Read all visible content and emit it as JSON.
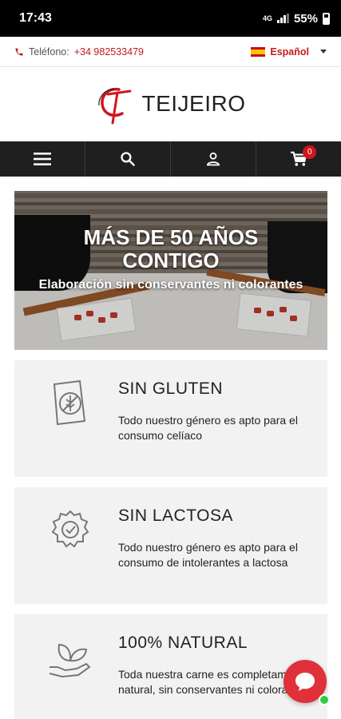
{
  "status_bar": {
    "time": "17:43",
    "network": "4G",
    "battery": "55%"
  },
  "topbar": {
    "phone_label": "Teléfono:",
    "phone_number": "+34 982533479",
    "language": "Español"
  },
  "brand": {
    "name": "TEIJEIRO",
    "accent": "#d0161c"
  },
  "navbar": {
    "menu_icon": "hamburger-icon",
    "search_icon": "search-icon",
    "account_icon": "user-icon",
    "cart_icon": "cart-icon",
    "cart_count": "0"
  },
  "hero": {
    "headline": "MÁS DE 50 AÑOS CONTIGO",
    "subheadline": "Elaboración sin conservantes ni colorantes"
  },
  "features": [
    {
      "icon": "gluten-free-icon",
      "title": "SIN GLUTEN",
      "description": "Todo nuestro género es apto para el consumo celíaco"
    },
    {
      "icon": "badge-check-icon",
      "title": "SIN LACTOSA",
      "description": "Todo nuestro género es apto para el consumo de intolerantes a lactosa"
    },
    {
      "icon": "leaf-hand-icon",
      "title": "100% NATURAL",
      "description": "Toda nuestra carne es completamente natural, sin conservantes ni colorantes"
    }
  ],
  "chat": {
    "icon": "chat-bubble-icon",
    "online_color": "#2ecc40"
  }
}
